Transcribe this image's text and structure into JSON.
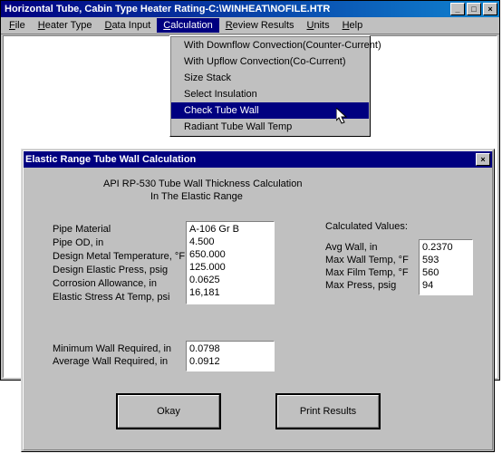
{
  "main_window": {
    "title": "Horizontal Tube, Cabin Type Heater Rating-C:\\WINHEAT\\NOFILE.HTR",
    "menus": {
      "file": "File",
      "heater_type": "Heater Type",
      "data_input": "Data Input",
      "calculation": "Calculation",
      "review_results": "Review Results",
      "units": "Units",
      "help": "Help"
    },
    "calculation_menu": {
      "downflow": "With Downflow Convection(Counter-Current)",
      "upflow": "With Upflow Convection(Co-Current)",
      "size_stack": "Size Stack",
      "select_insulation": "Select Insulation",
      "check_tube_wall": "Check Tube Wall",
      "radiant_tube_wall": "Radiant Tube Wall Temp"
    }
  },
  "dialog": {
    "title": "Elastic Range Tube Wall Calculation",
    "heading1": "API RP-530 Tube Wall Thickness Calculation",
    "heading2": "In The Elastic Range",
    "input_labels": {
      "pipe_material": "Pipe Material",
      "pipe_od": "Pipe OD, in",
      "design_metal_temp": "Design Metal Temperature, °F",
      "design_elastic_press": "Design Elastic Press, psig",
      "corrosion_allowance": "Corrosion Allowance, in",
      "elastic_stress": "Elastic Stress At Temp, psi"
    },
    "input_values": {
      "pipe_material": "A-106 Gr B",
      "pipe_od": "4.500",
      "design_metal_temp": "650.000",
      "design_elastic_press": "125.000",
      "corrosion_allowance": "0.0625",
      "elastic_stress": "16,181"
    },
    "calculated_heading": "Calculated Values:",
    "calc_labels": {
      "avg_wall": "Avg Wall, in",
      "max_wall_temp": "Max Wall Temp, °F",
      "max_film_temp": "Max Film Temp, °F",
      "max_press": "Max Press, psig"
    },
    "calc_values": {
      "avg_wall": "0.2370",
      "max_wall_temp": "593",
      "max_film_temp": "560",
      "max_press": "94"
    },
    "req_labels": {
      "min_wall": "Minimum Wall Required, in",
      "avg_wall": "Average Wall Required, in"
    },
    "req_values": {
      "min_wall": "0.0798",
      "avg_wall": "0.0912"
    },
    "buttons": {
      "okay": "Okay",
      "print": "Print Results"
    }
  }
}
